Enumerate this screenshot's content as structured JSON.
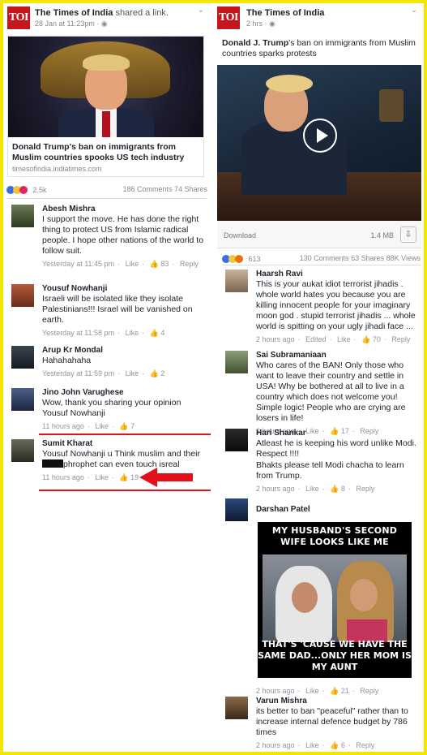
{
  "left_post": {
    "page_name": "The Times of India",
    "shared_text": "shared a link.",
    "timestamp": "28 Jan at 11:23pm",
    "logo_text": "TOI",
    "link_title": "Donald Trump's ban on immigrants from Muslim countries spooks US tech industry",
    "link_domain": "timesofindia.indiatimes.com",
    "reaction_count": "2.5k",
    "comments_shares": "186 Comments 74 Shares",
    "comments": [
      {
        "name": "Abesh Mishra",
        "text": "I support the move. He has done the right thing to protect US from Islamic radical people. I hope other nations of the world to follow suit.",
        "time": "Yesterday at 11:45 pm",
        "like": "Like",
        "count": "83",
        "reply": "Reply"
      },
      {
        "name": "Yousuf Nowhanji",
        "text": "Israeli will be isolated like they isolate Palestinians!!! Israel will be vanished on earth.",
        "time": "Yesterday at 11:58 pm",
        "like": "Like",
        "count": "4"
      },
      {
        "name": "Arup Kr Mondal",
        "text": "Hahahahaha",
        "time": "Yesterday at 11:59 pm",
        "like": "Like",
        "count": "2"
      },
      {
        "name": "Jino John Varughese",
        "text": "Wow, thank you sharing your opinion Yousuf Nowhanji",
        "time": "11 hours ago",
        "like": "Like",
        "count": "7"
      },
      {
        "name": "Sumit Kharat",
        "text_before": "Yousuf Nowhanji u Think muslim and their",
        "text_after": "phrophet can even touch isreal",
        "time": "11 hours ago",
        "like": "Like",
        "count": "19"
      }
    ]
  },
  "right_post": {
    "page_name": "The Times of India",
    "timestamp": "2 hrs",
    "logo_text": "TOI",
    "title_bold": "Donald J. Trump",
    "title_rest": "'s ban on immigrants from Muslim countries sparks protests",
    "download_label": "Download",
    "file_size": "1.4 MB",
    "reaction_count": "613",
    "stats": "130 Comments 63 Shares 88K Views",
    "comments": [
      {
        "name": "Haarsh Ravi",
        "text": "This is your aukat idiot terrorist jihadis . whole world hates you because you are killing innocent people for  your imaginary moon god . stupid terrorist jihadis ... whole world is spitting on your ugly jihadi face ...",
        "time": "2 hours ago",
        "edited": "Edited",
        "like": "Like",
        "count": "70",
        "reply": "Reply"
      },
      {
        "name": "Sai Subramaniaan",
        "text": "Who cares of the BAN! Only those who want to leave their country and settle in USA! Why be bothered at all to live in a country which does not welcome you! Simple logic! People who are crying are losers in life!",
        "time": "2 hours ago",
        "like": "Like",
        "count": "17",
        "reply": "Reply"
      },
      {
        "name": "Hari Shankar",
        "text": "Atleast he is keeping his word unlike Modi. Respect !!!!",
        "text2": "Bhakts please tell Modi chacha to learn from Trump.",
        "time": "2 hours ago",
        "like": "Like",
        "count": "8",
        "reply": "Reply"
      },
      {
        "name": "Darshan Patel",
        "meme_top": "MY HUSBAND'S SECOND WIFE LOOKS LIKE ME",
        "meme_bottom": "THAT'S 'CAUSE WE HAVE THE SAME DAD...ONLY HER MOM IS MY AUNT",
        "time": "2 hours ago",
        "like": "Like",
        "count": "21",
        "reply": "Reply"
      },
      {
        "name": "Varun Mishra",
        "text": "its better to ban \"peaceful\" rather than to increase internal defence budget by 786 times",
        "time": "2 hours ago",
        "like": "Like",
        "count": "6",
        "reply": "Reply"
      }
    ]
  },
  "colors": {
    "border": "#f2e600",
    "highlight": "#e3101b",
    "brand": "#c5161d"
  }
}
